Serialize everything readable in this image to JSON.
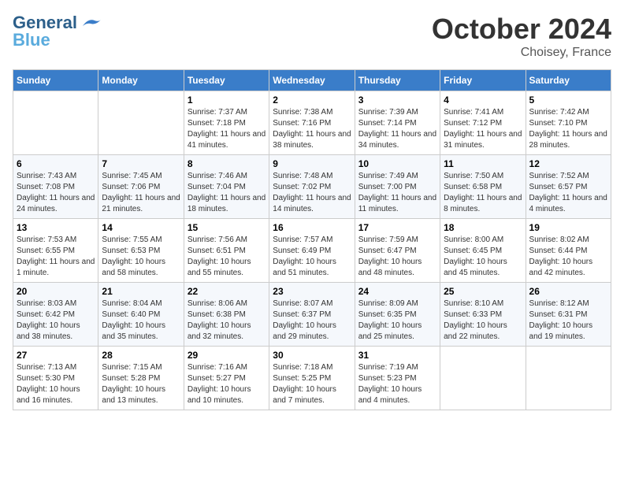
{
  "header": {
    "logo_line1": "General",
    "logo_line2": "Blue",
    "month": "October 2024",
    "location": "Choisey, France"
  },
  "weekdays": [
    "Sunday",
    "Monday",
    "Tuesday",
    "Wednesday",
    "Thursday",
    "Friday",
    "Saturday"
  ],
  "weeks": [
    [
      {
        "day": "",
        "sunrise": "",
        "sunset": "",
        "daylight": ""
      },
      {
        "day": "",
        "sunrise": "",
        "sunset": "",
        "daylight": ""
      },
      {
        "day": "1",
        "sunrise": "Sunrise: 7:37 AM",
        "sunset": "Sunset: 7:18 PM",
        "daylight": "Daylight: 11 hours and 41 minutes."
      },
      {
        "day": "2",
        "sunrise": "Sunrise: 7:38 AM",
        "sunset": "Sunset: 7:16 PM",
        "daylight": "Daylight: 11 hours and 38 minutes."
      },
      {
        "day": "3",
        "sunrise": "Sunrise: 7:39 AM",
        "sunset": "Sunset: 7:14 PM",
        "daylight": "Daylight: 11 hours and 34 minutes."
      },
      {
        "day": "4",
        "sunrise": "Sunrise: 7:41 AM",
        "sunset": "Sunset: 7:12 PM",
        "daylight": "Daylight: 11 hours and 31 minutes."
      },
      {
        "day": "5",
        "sunrise": "Sunrise: 7:42 AM",
        "sunset": "Sunset: 7:10 PM",
        "daylight": "Daylight: 11 hours and 28 minutes."
      }
    ],
    [
      {
        "day": "6",
        "sunrise": "Sunrise: 7:43 AM",
        "sunset": "Sunset: 7:08 PM",
        "daylight": "Daylight: 11 hours and 24 minutes."
      },
      {
        "day": "7",
        "sunrise": "Sunrise: 7:45 AM",
        "sunset": "Sunset: 7:06 PM",
        "daylight": "Daylight: 11 hours and 21 minutes."
      },
      {
        "day": "8",
        "sunrise": "Sunrise: 7:46 AM",
        "sunset": "Sunset: 7:04 PM",
        "daylight": "Daylight: 11 hours and 18 minutes."
      },
      {
        "day": "9",
        "sunrise": "Sunrise: 7:48 AM",
        "sunset": "Sunset: 7:02 PM",
        "daylight": "Daylight: 11 hours and 14 minutes."
      },
      {
        "day": "10",
        "sunrise": "Sunrise: 7:49 AM",
        "sunset": "Sunset: 7:00 PM",
        "daylight": "Daylight: 11 hours and 11 minutes."
      },
      {
        "day": "11",
        "sunrise": "Sunrise: 7:50 AM",
        "sunset": "Sunset: 6:58 PM",
        "daylight": "Daylight: 11 hours and 8 minutes."
      },
      {
        "day": "12",
        "sunrise": "Sunrise: 7:52 AM",
        "sunset": "Sunset: 6:57 PM",
        "daylight": "Daylight: 11 hours and 4 minutes."
      }
    ],
    [
      {
        "day": "13",
        "sunrise": "Sunrise: 7:53 AM",
        "sunset": "Sunset: 6:55 PM",
        "daylight": "Daylight: 11 hours and 1 minute."
      },
      {
        "day": "14",
        "sunrise": "Sunrise: 7:55 AM",
        "sunset": "Sunset: 6:53 PM",
        "daylight": "Daylight: 10 hours and 58 minutes."
      },
      {
        "day": "15",
        "sunrise": "Sunrise: 7:56 AM",
        "sunset": "Sunset: 6:51 PM",
        "daylight": "Daylight: 10 hours and 55 minutes."
      },
      {
        "day": "16",
        "sunrise": "Sunrise: 7:57 AM",
        "sunset": "Sunset: 6:49 PM",
        "daylight": "Daylight: 10 hours and 51 minutes."
      },
      {
        "day": "17",
        "sunrise": "Sunrise: 7:59 AM",
        "sunset": "Sunset: 6:47 PM",
        "daylight": "Daylight: 10 hours and 48 minutes."
      },
      {
        "day": "18",
        "sunrise": "Sunrise: 8:00 AM",
        "sunset": "Sunset: 6:45 PM",
        "daylight": "Daylight: 10 hours and 45 minutes."
      },
      {
        "day": "19",
        "sunrise": "Sunrise: 8:02 AM",
        "sunset": "Sunset: 6:44 PM",
        "daylight": "Daylight: 10 hours and 42 minutes."
      }
    ],
    [
      {
        "day": "20",
        "sunrise": "Sunrise: 8:03 AM",
        "sunset": "Sunset: 6:42 PM",
        "daylight": "Daylight: 10 hours and 38 minutes."
      },
      {
        "day": "21",
        "sunrise": "Sunrise: 8:04 AM",
        "sunset": "Sunset: 6:40 PM",
        "daylight": "Daylight: 10 hours and 35 minutes."
      },
      {
        "day": "22",
        "sunrise": "Sunrise: 8:06 AM",
        "sunset": "Sunset: 6:38 PM",
        "daylight": "Daylight: 10 hours and 32 minutes."
      },
      {
        "day": "23",
        "sunrise": "Sunrise: 8:07 AM",
        "sunset": "Sunset: 6:37 PM",
        "daylight": "Daylight: 10 hours and 29 minutes."
      },
      {
        "day": "24",
        "sunrise": "Sunrise: 8:09 AM",
        "sunset": "Sunset: 6:35 PM",
        "daylight": "Daylight: 10 hours and 25 minutes."
      },
      {
        "day": "25",
        "sunrise": "Sunrise: 8:10 AM",
        "sunset": "Sunset: 6:33 PM",
        "daylight": "Daylight: 10 hours and 22 minutes."
      },
      {
        "day": "26",
        "sunrise": "Sunrise: 8:12 AM",
        "sunset": "Sunset: 6:31 PM",
        "daylight": "Daylight: 10 hours and 19 minutes."
      }
    ],
    [
      {
        "day": "27",
        "sunrise": "Sunrise: 7:13 AM",
        "sunset": "Sunset: 5:30 PM",
        "daylight": "Daylight: 10 hours and 16 minutes."
      },
      {
        "day": "28",
        "sunrise": "Sunrise: 7:15 AM",
        "sunset": "Sunset: 5:28 PM",
        "daylight": "Daylight: 10 hours and 13 minutes."
      },
      {
        "day": "29",
        "sunrise": "Sunrise: 7:16 AM",
        "sunset": "Sunset: 5:27 PM",
        "daylight": "Daylight: 10 hours and 10 minutes."
      },
      {
        "day": "30",
        "sunrise": "Sunrise: 7:18 AM",
        "sunset": "Sunset: 5:25 PM",
        "daylight": "Daylight: 10 hours and 7 minutes."
      },
      {
        "day": "31",
        "sunrise": "Sunrise: 7:19 AM",
        "sunset": "Sunset: 5:23 PM",
        "daylight": "Daylight: 10 hours and 4 minutes."
      },
      {
        "day": "",
        "sunrise": "",
        "sunset": "",
        "daylight": ""
      },
      {
        "day": "",
        "sunrise": "",
        "sunset": "",
        "daylight": ""
      }
    ]
  ]
}
